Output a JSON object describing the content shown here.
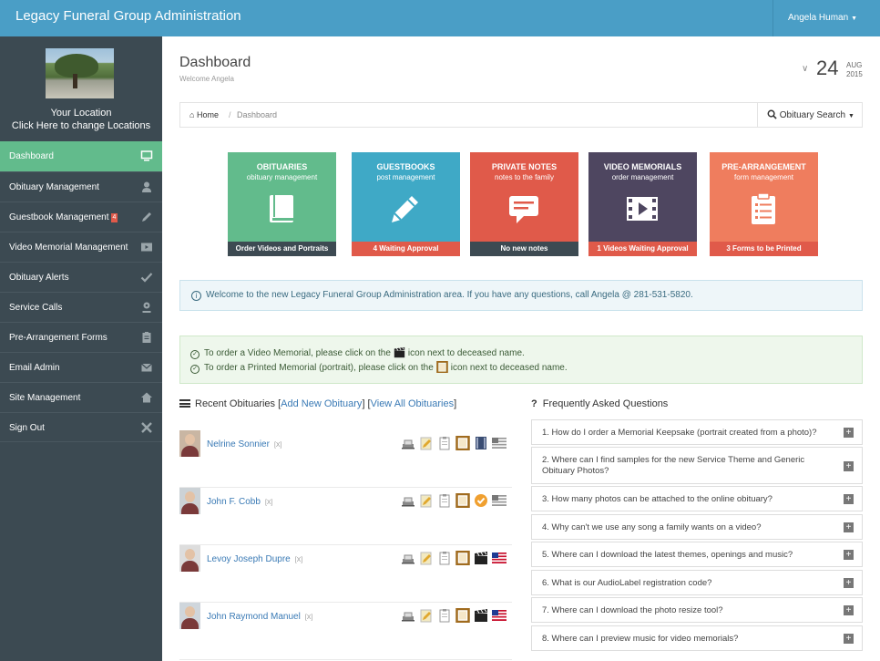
{
  "header": {
    "app_title": "Legacy Funeral Group Administration",
    "user_name": "Angela Human"
  },
  "sidebar": {
    "location_line1": "Your Location",
    "location_line2": "Click Here to change Locations",
    "items": [
      {
        "label": "Dashboard",
        "icon": "monitor-icon",
        "active": true
      },
      {
        "label": "Obituary Management",
        "icon": "user-icon"
      },
      {
        "label": "Guestbook Management",
        "badge": "4",
        "icon": "pencil-icon"
      },
      {
        "label": "Video Memorial Management",
        "icon": "film-icon"
      },
      {
        "label": "Obituary Alerts",
        "icon": "check-icon"
      },
      {
        "label": "Service Calls",
        "icon": "map-pin-icon"
      },
      {
        "label": "Pre-Arrangement Forms",
        "icon": "clipboard-icon"
      },
      {
        "label": "Email Admin",
        "icon": "envelope-icon"
      },
      {
        "label": "Site Management",
        "icon": "home-icon"
      },
      {
        "label": "Sign Out",
        "icon": "close-icon"
      }
    ]
  },
  "page": {
    "title": "Dashboard",
    "welcome": "Welcome Angela",
    "date_day": "24",
    "date_month": "AUG",
    "date_year": "2015"
  },
  "breadcrumb": {
    "home": "Home",
    "current": "Dashboard",
    "search_label": "Obituary Search"
  },
  "tiles": [
    {
      "title": "OBITUARIES",
      "subtitle": "obituary management",
      "footer": "Order Videos and Portraits",
      "color": "#62bb8c",
      "footer_color": "#3d4a52",
      "icon": "book-icon"
    },
    {
      "title": "GUESTBOOKS",
      "subtitle": "post management",
      "footer": "4 Waiting Approval",
      "color": "#3fa9c6",
      "footer_color": "#e05a4a",
      "icon": "pencil-icon"
    },
    {
      "title": "PRIVATE NOTES",
      "subtitle": "notes to the family",
      "footer": "No new notes",
      "color": "#e05a4a",
      "footer_color": "#3d4a52",
      "icon": "speech-bubble-icon"
    },
    {
      "title": "VIDEO MEMORIALS",
      "subtitle": "order management",
      "footer": "1 Videos Waiting Approval",
      "color": "#4e4660",
      "footer_color": "#e05a4a",
      "icon": "film-icon"
    },
    {
      "title": "PRE-ARRANGEMENT",
      "subtitle": "form management",
      "footer": "3 Forms to be Printed",
      "color": "#ef7d5e",
      "footer_color": "#e05a4a",
      "icon": "clipboard-icon"
    }
  ],
  "info_message": "Welcome to the new Legacy Funeral Group Administration area. If you have any questions, call Angela @ 281-531-5820.",
  "notes": {
    "line1_before": "To order a Video Memorial, please click on the",
    "line1_after": "icon next to deceased name.",
    "line2_before": "To order a Printed Memorial (portrait), please click on the",
    "line2_after": "icon next to deceased name."
  },
  "recent": {
    "heading": "Recent Obituaries",
    "add_link": "Add New Obituary",
    "view_link": "View All Obituaries",
    "remove_label": "[X]",
    "items": [
      {
        "name": "Nelrine Sonnier"
      },
      {
        "name": "John F. Cobb"
      },
      {
        "name": "Levoy Joseph Dupre"
      },
      {
        "name": "John Raymond Manuel"
      }
    ]
  },
  "faq": {
    "heading": "Frequently Asked Questions",
    "items": [
      {
        "q": "1. How do I order a Memorial Keepsake (portrait created from a photo)?"
      },
      {
        "q": "2. Where can I find samples for the new Service Theme and Generic Obituary Photos?"
      },
      {
        "q": "3. How many photos can be attached to the online obituary?"
      },
      {
        "q": "4. Why can't we use any song a family wants on a video?"
      },
      {
        "q": "5. Where can I download the latest themes, openings and music?"
      },
      {
        "q": "6. What is our AudioLabel registration code?"
      },
      {
        "q": "7. Where can I download the photo resize tool?"
      },
      {
        "q": "8. Where can I preview music for video memorials?"
      }
    ]
  }
}
